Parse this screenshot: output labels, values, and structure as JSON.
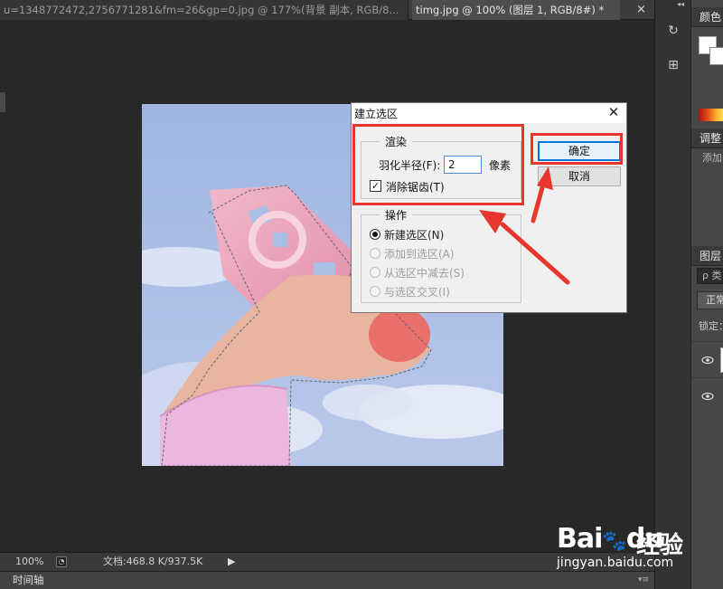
{
  "tabs": [
    {
      "label": "u=1348772472,2756771281&fm=26&gp=0.jpg @ 177%(背景 副本, RGB/8..."
    },
    {
      "label": "timg.jpg @ 100% (图层 1, RGB/8#) *"
    }
  ],
  "tab_close": "×",
  "status": {
    "zoom": "100%",
    "doc": "文档:468.8 K/937.5K",
    "arrow": "▶"
  },
  "timeline": {
    "label": "时间轴",
    "menu": "▾≡"
  },
  "right_tools": {
    "collapse": "◂◂"
  },
  "panels": {
    "color": "颜色",
    "adjustments": "调整",
    "adjust_add": "添加",
    "layers": "图层",
    "layer_search": "ρ 类",
    "blend_mode": "正常",
    "lock": "锁定："
  },
  "dialog": {
    "title": "建立选区",
    "close": "✕",
    "render_group": "渲染",
    "feather_label": "羽化半径(F):",
    "feather_value": "2",
    "feather_unit": "像素",
    "antialias_label": "消除锯齿(T)",
    "antialias_checked": true,
    "operation_group": "操作",
    "operations": [
      {
        "label": "新建选区(N)",
        "checked": true,
        "disabled": false
      },
      {
        "label": "添加到选区(A)",
        "checked": false,
        "disabled": true
      },
      {
        "label": "从选区中减去(S)",
        "checked": false,
        "disabled": true
      },
      {
        "label": "与选区交叉(I)",
        "checked": false,
        "disabled": true
      }
    ],
    "ok_label": "确定",
    "cancel_label": "取消"
  },
  "watermark": {
    "bai": "Bai",
    "du": "du",
    "jingyan": "经验",
    "url": "jingyan.baidu.com"
  },
  "colors": {
    "annotation": "#e8362f",
    "sky": "#a9bfe5",
    "cloth": "#e7b3d9",
    "skin": "#e8b6a0"
  }
}
